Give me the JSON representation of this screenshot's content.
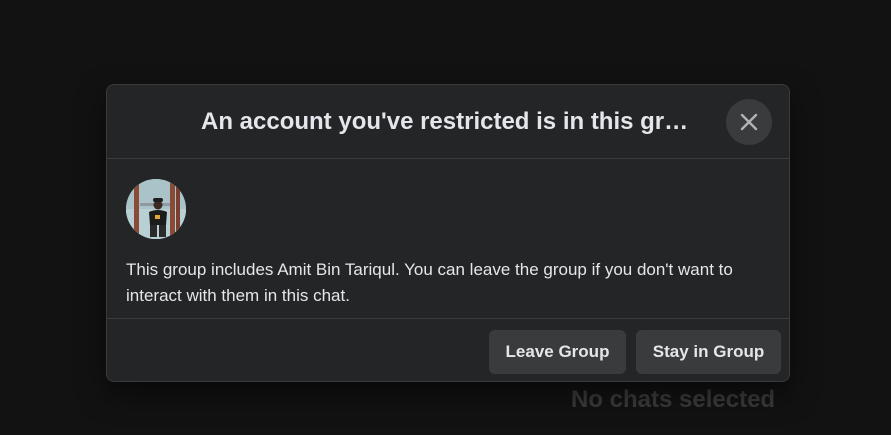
{
  "background": {
    "empty_state_text": "No chats selected"
  },
  "dialog": {
    "title": "An account you've restricted is in this group",
    "message": "This group includes Amit Bin Tariqul. You can leave the group if you don't want to interact with them in this chat.",
    "close_icon": "close-icon",
    "avatar_alt": "Amit Bin Tariqul",
    "buttons": {
      "leave_label": "Leave Group",
      "stay_label": "Stay in Group"
    }
  },
  "colors": {
    "page_background": "#121212",
    "dialog_background": "#242526",
    "divider": "#3a3b3c",
    "button_background": "#3a3b3c",
    "text_primary": "#e4e6eb",
    "empty_state_text": "#3a3b3c"
  }
}
